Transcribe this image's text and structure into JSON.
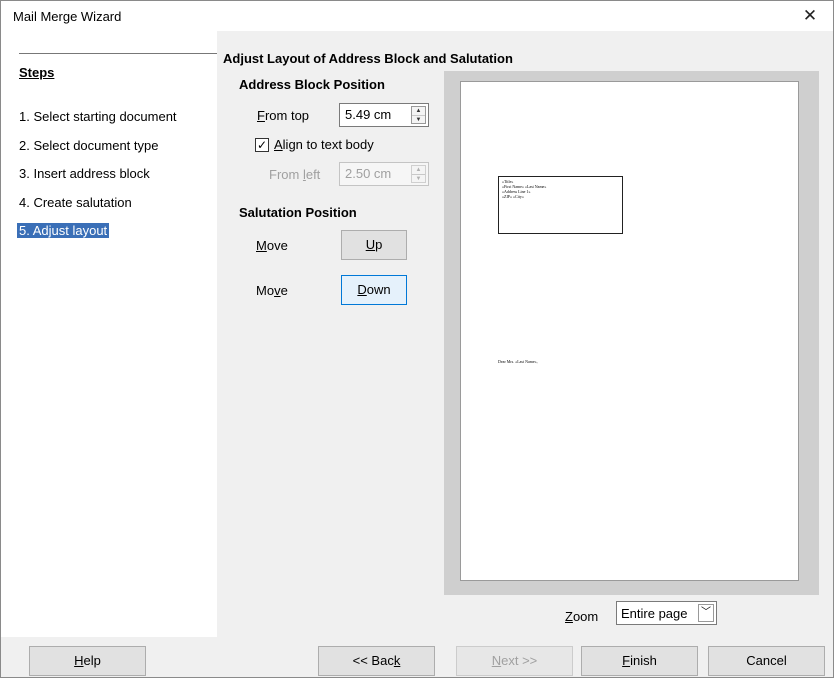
{
  "window": {
    "title": "Mail Merge Wizard",
    "close_glyph": "✕"
  },
  "steps": {
    "title": "Steps",
    "items": [
      {
        "label": "1. Select starting document"
      },
      {
        "label": "2. Select document type"
      },
      {
        "label": "3. Insert address block"
      },
      {
        "label": "4. Create salutation"
      },
      {
        "label": "5. Adjust layout",
        "active": true
      }
    ]
  },
  "content": {
    "heading": "Adjust Layout of Address Block and Salutation",
    "address_block": {
      "heading": "Address Block Position",
      "from_top": {
        "label_mnemonic": "F",
        "label_rest": "rom top",
        "value": "5.49 cm"
      },
      "align_text_body": {
        "checked": true,
        "label_mnemonic": "A",
        "label_rest": "lign to text body"
      },
      "from_left": {
        "label_pre": "From ",
        "label_mnemonic": "l",
        "label_rest": "eft",
        "value": "2.50 cm",
        "disabled": true
      }
    },
    "salutation": {
      "heading": "Salutation Position",
      "move_up_label": {
        "mnemonic": "M",
        "rest": "ove"
      },
      "up_button": {
        "mnemonic": "U",
        "rest": "p"
      },
      "move_down_label": {
        "pre": "Mo",
        "mnemonic": "v",
        "rest": "e"
      },
      "down_button": {
        "mnemonic": "D",
        "rest": "own"
      }
    }
  },
  "preview": {
    "address_lines": [
      "«Title»",
      "«First Name» «Last Name»",
      "«Address Line 1»",
      "«ZIP» «City»"
    ],
    "salutation_text": "Dear Mrs. «Last Name»,"
  },
  "zoom": {
    "label_mnemonic": "Z",
    "label_rest": "oom",
    "value": "Entire page"
  },
  "footer": {
    "help": {
      "mnemonic": "H",
      "rest": "elp"
    },
    "back": {
      "pre": "<< Bac",
      "mnemonic": "k"
    },
    "next": {
      "mnemonic": "N",
      "rest": "ext >>"
    },
    "finish": {
      "mnemonic": "F",
      "rest": "inish"
    },
    "cancel": "Cancel"
  },
  "colors": {
    "selection": "#3a6fb7",
    "focus_border": "#0078d7"
  }
}
